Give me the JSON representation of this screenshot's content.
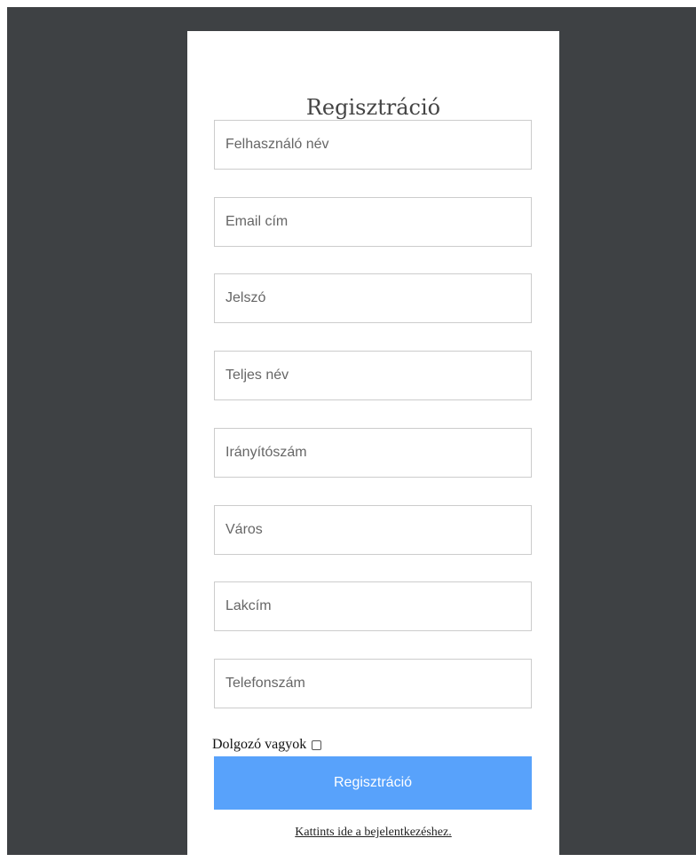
{
  "form": {
    "title": "Regisztráció",
    "fields": [
      {
        "placeholder": "Felhasználó név",
        "value": ""
      },
      {
        "placeholder": "Email cím",
        "value": ""
      },
      {
        "placeholder": "Jelszó",
        "value": ""
      },
      {
        "placeholder": "Teljes név",
        "value": ""
      },
      {
        "placeholder": "Irányítószám",
        "value": ""
      },
      {
        "placeholder": "Város",
        "value": ""
      },
      {
        "placeholder": "Lakcím",
        "value": ""
      },
      {
        "placeholder": "Telefonszám",
        "value": ""
      }
    ],
    "employee_label": "Dolgozó vagyok",
    "employee_checked": false,
    "submit_label": "Regisztráció",
    "login_link_text": "Kattints ide a bejelentkezéshez."
  },
  "colors": {
    "background": "#3e4144",
    "card": "#ffffff",
    "submit_button": "#58a2fb",
    "field_border": "#cccccc"
  }
}
